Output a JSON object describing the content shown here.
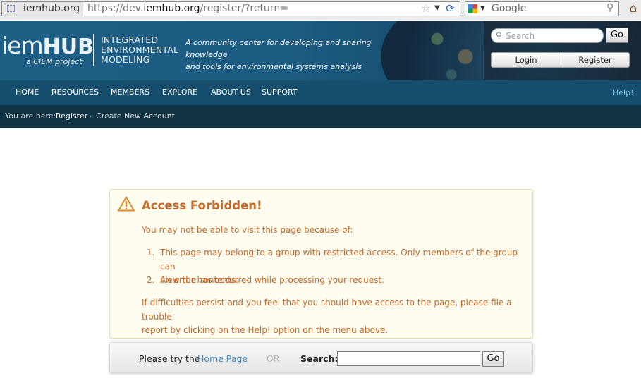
{
  "browser": {
    "site_domain": "iemhub.org",
    "url_prefix": "https://dev.",
    "url_domain": "iemhub.org",
    "url_path": "/register/?return=",
    "search_engine": "Google",
    "icons": [
      "site-icon",
      "star-icon",
      "dropdown-icon",
      "reload-icon",
      "google-icon",
      "magnifier-icon",
      "home-icon"
    ]
  },
  "header": {
    "logo_main": "iem",
    "logo_hub": "HUB",
    "logo_tagline": "a CIEM project",
    "subtitle_lines": [
      "INTEGRATED",
      "ENVIRONMENTAL",
      "MODELING"
    ],
    "tagline_lines": [
      "A community center for developing and sharing knowledge",
      "and tools for environmental systems analysis"
    ],
    "search_placeholder": "Search",
    "go_label": "Go",
    "login_label": "Login",
    "register_label": "Register"
  },
  "nav": {
    "items": [
      "HOME",
      "RESOURCES",
      "MEMBERS",
      "EXPLORE",
      "ABOUT US",
      "SUPPORT"
    ],
    "help": "Help!"
  },
  "breadcrumb": {
    "prefix": "You are here:",
    "items": [
      "Register",
      "Create New Account"
    ],
    "separator": "›"
  },
  "notice": {
    "title": "Access Forbidden!",
    "intro": "You may not be able to visit this page because of:",
    "reasons": [
      {
        "num": "1.",
        "lines": [
          "This page may belong to a group with restricted access. Only members of the group can",
          "view the contents."
        ]
      },
      {
        "num": "2.",
        "lines": [
          "An error has occurred while processing your request."
        ]
      }
    ],
    "footer_lines": [
      "If difficulties persist and you feel that you should have access to the page, please file a trouble",
      "report by clicking on the Help! option on the menu above."
    ],
    "accent_color": "#c46a2b"
  },
  "try_box": {
    "prefix": "Please try the",
    "home_link": "Home Page",
    "or": "OR",
    "search_label": "Search:",
    "search_value": "",
    "go_label": "Go"
  }
}
